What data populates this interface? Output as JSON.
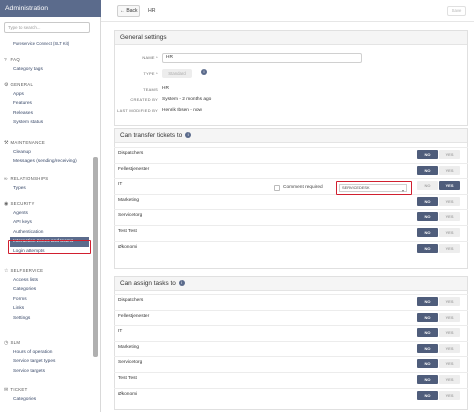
{
  "sidebar": {
    "title": "Administration",
    "search_placeholder": "Type to search...",
    "top_item": "Pureservice Connect (SLT Kit)",
    "sections": [
      {
        "label": "FAQ",
        "items": [
          "Category tags"
        ]
      },
      {
        "label": "GENERAL",
        "items": [
          "Apps",
          "Features",
          "Releases",
          "System status"
        ]
      },
      {
        "label": "MAINTENANCE",
        "items": [
          "Cleanup",
          "Messages (sending/receiving)"
        ]
      },
      {
        "label": "RELATIONSHIPS",
        "items": [
          "Types"
        ]
      },
      {
        "label": "SECURITY",
        "items": [
          "Agents",
          "API keys",
          "Authentication",
          "Interaction zones and teams",
          "Login attempts"
        ]
      },
      {
        "label": "SELFSERVICE",
        "items": [
          "Access lists",
          "Categories",
          "Forms",
          "Links",
          "Settings"
        ]
      },
      {
        "label": "SLM",
        "items": [
          "Hours of operation",
          "Service target types",
          "Service targets"
        ]
      },
      {
        "label": "TICKET",
        "items": [
          "Categories"
        ]
      }
    ],
    "active_item": "Interaction zones and teams"
  },
  "topbar": {
    "back_label": "Back",
    "breadcrumb": "HR",
    "save_label": "Save"
  },
  "general": {
    "heading": "General settings",
    "name_label": "NAME *",
    "name_value": "HR",
    "type_label": "TYPE *",
    "type_value": "Standard",
    "teams_label": "TEAMS",
    "teams_value": "HR",
    "created_label": "CREATED BY",
    "created_value": "System - 2 months ago",
    "modified_label": "LAST MODIFIED BY",
    "modified_value": "Henrik Ibsen - now"
  },
  "transfer": {
    "heading": "Can transfer tickets to",
    "comment_label": "Comment required",
    "servicedesk_value": "SERVICEDESK",
    "rows": [
      {
        "label": "Dispatchers",
        "no": "NO",
        "yes": "YES",
        "selected": "no"
      },
      {
        "label": "Fellestjenester",
        "no": "NO",
        "yes": "YES",
        "selected": "no"
      },
      {
        "label": "IT",
        "no": "NO",
        "yes": "YES",
        "selected": "yes"
      },
      {
        "label": "Marketing",
        "no": "NO",
        "yes": "YES",
        "selected": "no"
      },
      {
        "label": "Servicetorg",
        "no": "NO",
        "yes": "YES",
        "selected": "no"
      },
      {
        "label": "Test Test",
        "no": "NO",
        "yes": "YES",
        "selected": "no"
      },
      {
        "label": "Økonomi",
        "no": "NO",
        "yes": "YES",
        "selected": "no"
      }
    ]
  },
  "assign": {
    "heading": "Can assign tasks to",
    "rows": [
      {
        "label": "Dispatchers",
        "no": "NO",
        "yes": "YES",
        "selected": "no"
      },
      {
        "label": "Fellestjenester",
        "no": "NO",
        "yes": "YES",
        "selected": "no"
      },
      {
        "label": "IT",
        "no": "NO",
        "yes": "YES",
        "selected": "no"
      },
      {
        "label": "Marketing",
        "no": "NO",
        "yes": "YES",
        "selected": "no"
      },
      {
        "label": "Servicetorg",
        "no": "NO",
        "yes": "YES",
        "selected": "no"
      },
      {
        "label": "Test Test",
        "no": "NO",
        "yes": "YES",
        "selected": "no"
      },
      {
        "label": "Økonomi",
        "no": "NO",
        "yes": "YES",
        "selected": "no"
      }
    ]
  },
  "colors": {
    "accent": "#5b6b8c",
    "toggle_on": "#4f5d7b",
    "highlight": "#d11f2f"
  }
}
